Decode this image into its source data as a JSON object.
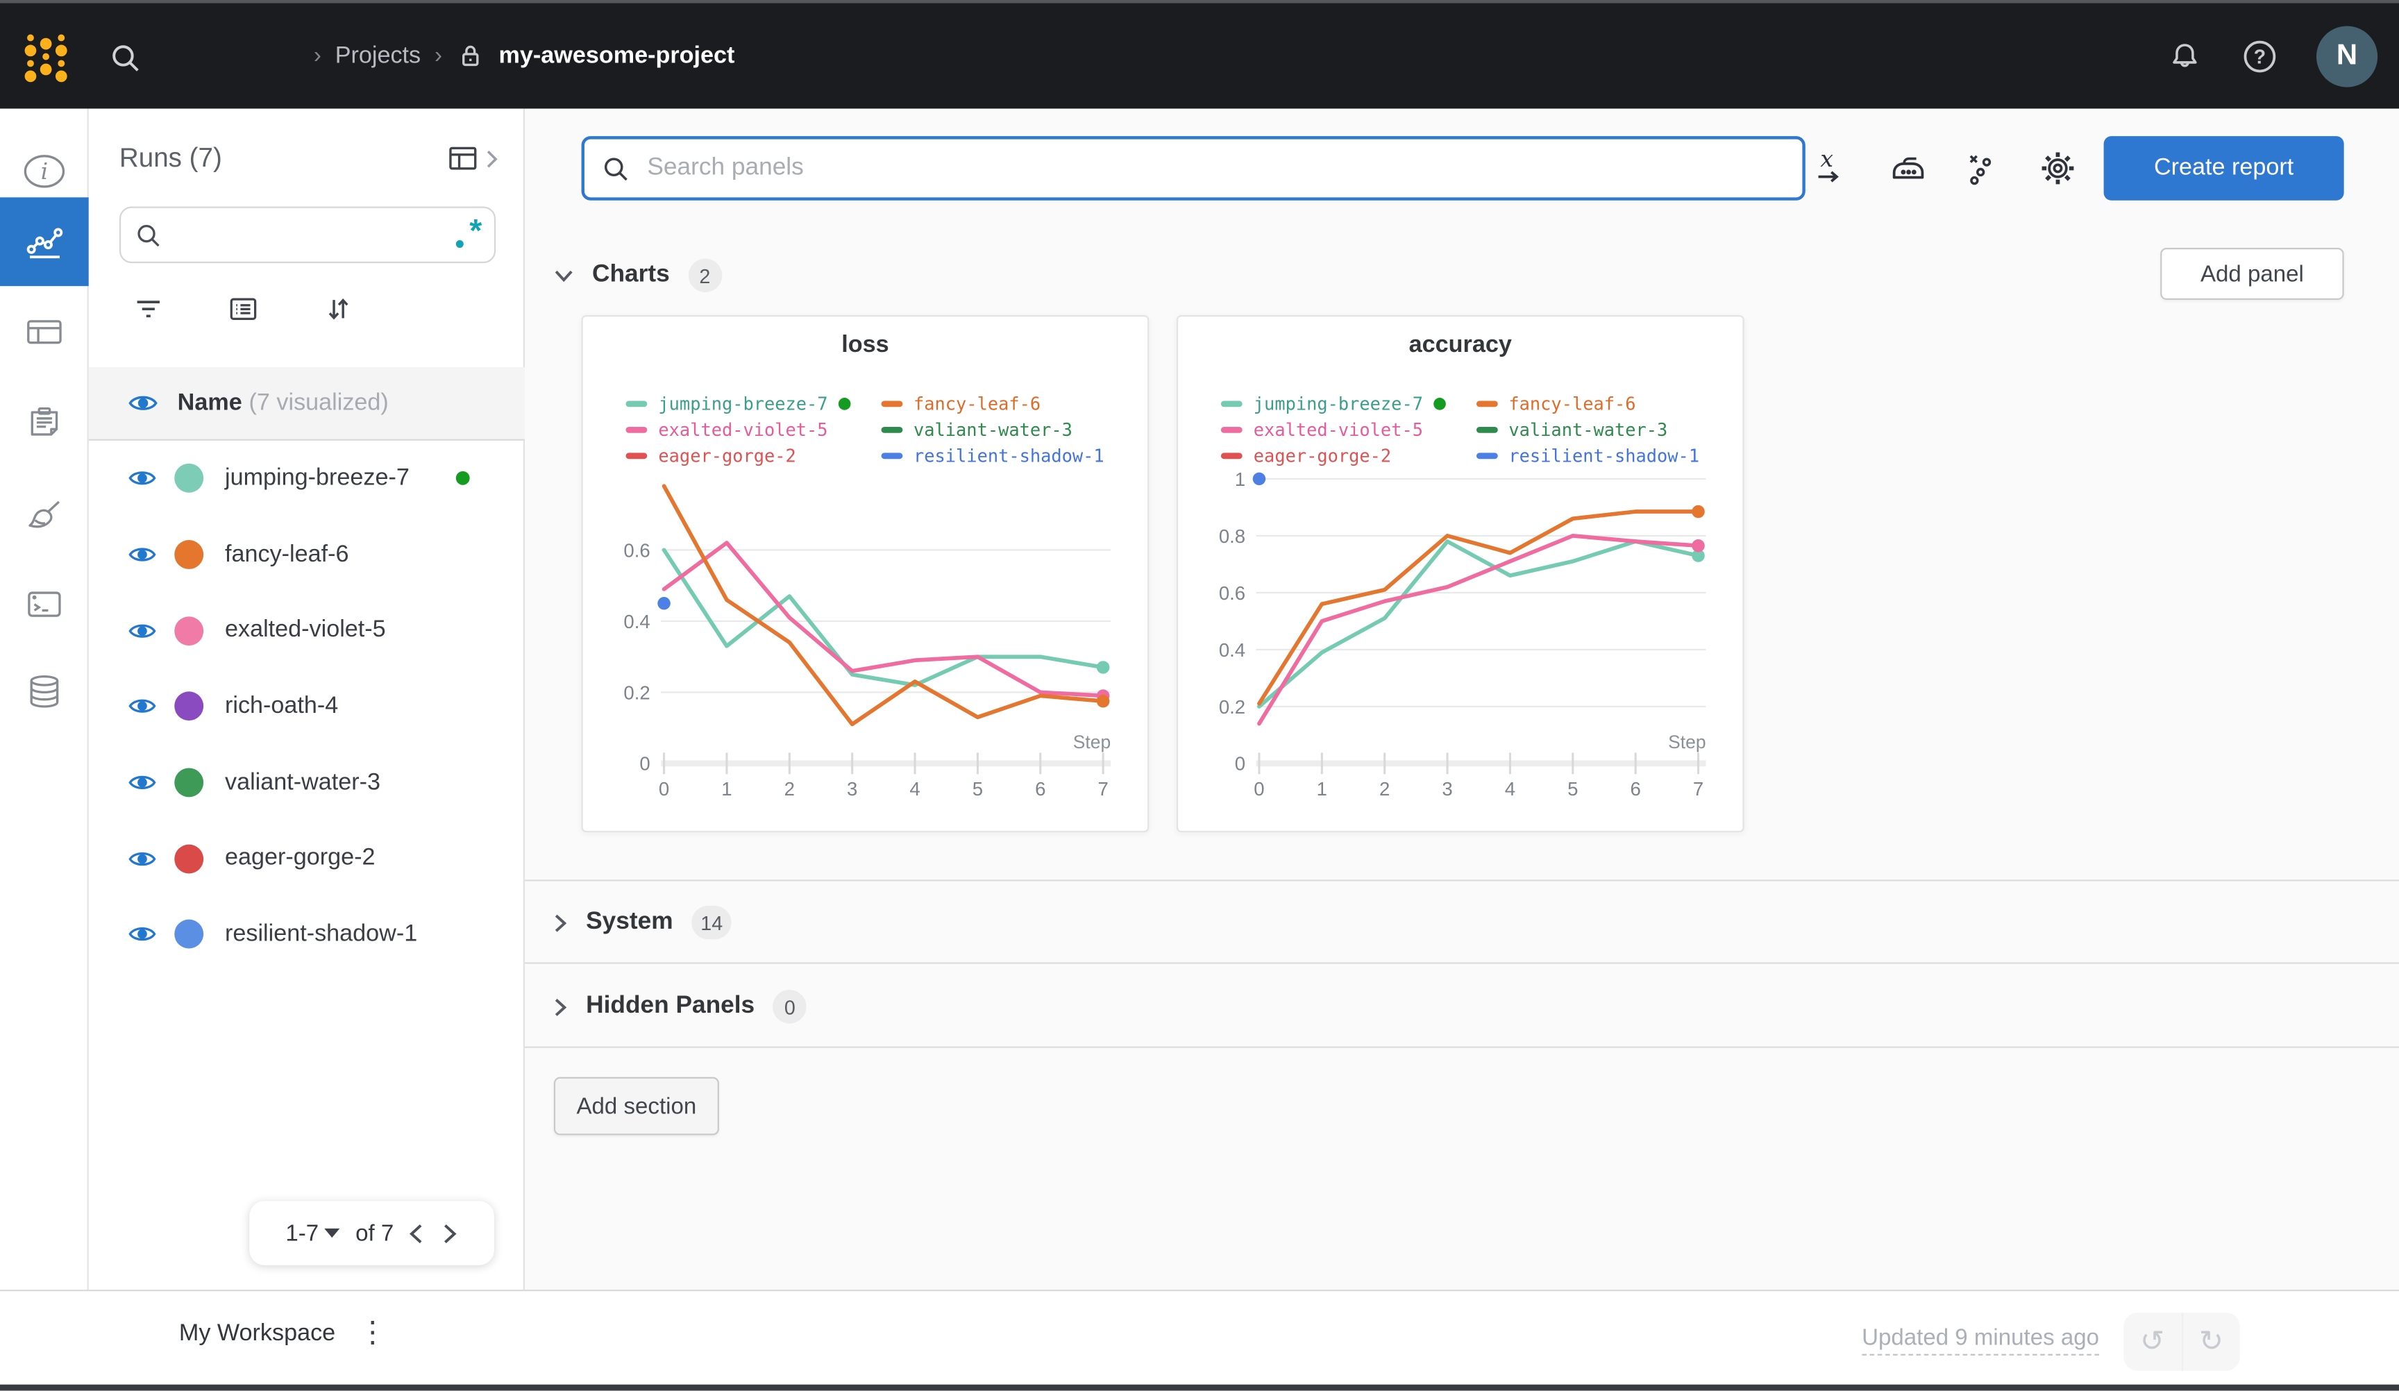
{
  "topbar": {
    "breadcrumb": {
      "sep": "›",
      "projects": "Projects",
      "project": "my-awesome-project"
    },
    "avatar": "N"
  },
  "rail": {
    "items": [
      "info-icon",
      "line-chart-icon",
      "table-icon",
      "clipboard-icon",
      "broom-icon",
      "terminal-icon",
      "database-icon"
    ],
    "active_index": 1,
    "active_color": "#2a77c9"
  },
  "runs_panel": {
    "title": "Runs (7)",
    "search_placeholder": "",
    "regex_icon": ".*",
    "header": {
      "name_label": "Name",
      "visualized": "(7 visualized)"
    },
    "runs": [
      {
        "name": "jumping-breeze-7",
        "color": "#7dccb5",
        "running": true
      },
      {
        "name": "fancy-leaf-6",
        "color": "#e4762e",
        "running": false
      },
      {
        "name": "exalted-violet-5",
        "color": "#ef7ba6",
        "running": false
      },
      {
        "name": "rich-oath-4",
        "color": "#8a4ac0",
        "running": false
      },
      {
        "name": "valiant-water-3",
        "color": "#3d9a57",
        "running": false
      },
      {
        "name": "eager-gorge-2",
        "color": "#d94a48",
        "running": false
      },
      {
        "name": "resilient-shadow-1",
        "color": "#5b8fe4",
        "running": false
      }
    ],
    "pagination": {
      "range": "1-7",
      "of": "of 7"
    }
  },
  "panels": {
    "search_placeholder": "Search panels",
    "create_report": "Create report",
    "add_panel": "Add panel",
    "add_section": "Add section",
    "sections": [
      {
        "label": "Charts",
        "count": "2",
        "expanded": true
      },
      {
        "label": "System",
        "count": "14",
        "expanded": false
      },
      {
        "label": "Hidden Panels",
        "count": "0",
        "expanded": false
      }
    ]
  },
  "footer": {
    "workspace": "My Workspace",
    "updated": "Updated 9 minutes ago"
  },
  "chart_data": [
    {
      "type": "line",
      "title": "loss",
      "xlabel": "Step",
      "x": [
        0,
        1,
        2,
        3,
        4,
        5,
        6,
        7
      ],
      "x_ticks": [
        0,
        1,
        2,
        3,
        4,
        5,
        6,
        7
      ],
      "ylim": [
        0,
        0.8
      ],
      "y_ticks": [
        0,
        0.2,
        0.4,
        0.6
      ],
      "grid": true,
      "legend_position": "top",
      "series": [
        {
          "name": "jumping-breeze-7",
          "color": "#74cbb2",
          "text_color": "#3a9e8b",
          "running": true,
          "end_dot": true,
          "values": [
            0.6,
            0.33,
            0.47,
            0.25,
            0.22,
            0.3,
            0.3,
            0.27
          ]
        },
        {
          "name": "fancy-leaf-6",
          "color": "#e4762f",
          "text_color": "#dd6c2a",
          "running": false,
          "end_dot": true,
          "values": [
            0.78,
            0.46,
            0.34,
            0.11,
            0.23,
            0.13,
            0.19,
            0.175
          ]
        },
        {
          "name": "exalted-violet-5",
          "color": "#ef6ba0",
          "text_color": "#e75b98",
          "running": false,
          "end_dot": true,
          "values": [
            0.49,
            0.62,
            0.41,
            0.26,
            0.29,
            0.3,
            0.2,
            0.19
          ]
        },
        {
          "name": "valiant-water-3",
          "color": "#2f8a4e",
          "text_color": "#2f8a4e",
          "running": false,
          "values": []
        },
        {
          "name": "eager-gorge-2",
          "color": "#e05151",
          "text_color": "#e05151",
          "running": false,
          "values": []
        },
        {
          "name": "resilient-shadow-1",
          "color": "#4c80e5",
          "text_color": "#4273e0",
          "running": false,
          "point_only": true,
          "values": [
            0.45
          ]
        }
      ]
    },
    {
      "type": "line",
      "title": "accuracy",
      "xlabel": "Step",
      "x": [
        0,
        1,
        2,
        3,
        4,
        5,
        6,
        7
      ],
      "x_ticks": [
        0,
        1,
        2,
        3,
        4,
        5,
        6,
        7
      ],
      "ylim": [
        0,
        1.0
      ],
      "y_ticks": [
        0,
        0.2,
        0.4,
        0.6,
        0.8,
        1
      ],
      "grid": true,
      "legend_position": "top",
      "series": [
        {
          "name": "jumping-breeze-7",
          "color": "#74cbb2",
          "text_color": "#3a9e8b",
          "running": true,
          "end_dot": true,
          "values": [
            0.2,
            0.39,
            0.51,
            0.78,
            0.66,
            0.71,
            0.78,
            0.73
          ]
        },
        {
          "name": "fancy-leaf-6",
          "color": "#e4762f",
          "text_color": "#dd6c2a",
          "running": false,
          "end_dot": true,
          "values": [
            0.21,
            0.56,
            0.61,
            0.8,
            0.74,
            0.86,
            0.885,
            0.885
          ]
        },
        {
          "name": "exalted-violet-5",
          "color": "#ef6ba0",
          "text_color": "#e75b98",
          "running": false,
          "end_dot": true,
          "values": [
            0.14,
            0.5,
            0.57,
            0.62,
            0.71,
            0.8,
            0.78,
            0.765
          ]
        },
        {
          "name": "valiant-water-3",
          "color": "#2f8a4e",
          "text_color": "#2f8a4e",
          "running": false,
          "values": []
        },
        {
          "name": "eager-gorge-2",
          "color": "#e05151",
          "text_color": "#e05151",
          "running": false,
          "values": []
        },
        {
          "name": "resilient-shadow-1",
          "color": "#4c80e5",
          "text_color": "#4273e0",
          "running": false,
          "point_only": true,
          "values": [
            1.0
          ]
        }
      ]
    }
  ],
  "colors": {
    "topbar_bg": "#1a1c20",
    "accent_blue": "#2e78d2",
    "rail_active": "#2a77c9",
    "running_green": "#149c20",
    "regex_teal": "#12a3b4"
  }
}
